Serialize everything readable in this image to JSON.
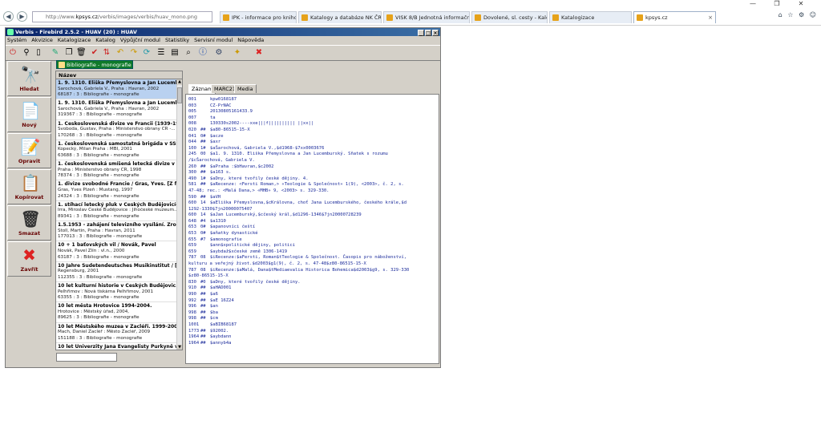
{
  "browser": {
    "address": {
      "prefix": "http://www.",
      "host": "kpsys.cz",
      "path": "/verbis/images/verbis/huav_mono.png"
    },
    "tabs": [
      {
        "label": "IPK - informace pro knihovny",
        "active": false
      },
      {
        "label": "Katalogy a databáze NK ČR",
        "active": false
      },
      {
        "label": "VISK 8/B Jednotná informační...",
        "active": false
      },
      {
        "label": "Dovolené, sl. cesty - Kalendář",
        "active": false
      },
      {
        "label": "Katalogizace",
        "active": false
      },
      {
        "label": "kpsys.cz",
        "active": true
      }
    ],
    "window_controls": {
      "minimize": "—",
      "maximize": "❐",
      "close": "✕"
    },
    "right_icons": "⌂ ☆ ⚙ ☺"
  },
  "app": {
    "title": "Verbis - Firebird 2.5.2 - HUAV (20) : HUAV",
    "menu": [
      "Systém",
      "Akvizice",
      "Katalogizace",
      "Katalog",
      "Výpůjční modul",
      "Statistiky",
      "Servisní modul",
      "Nápověda"
    ],
    "doc_tab": "Bibliografie - monografie",
    "actions": [
      {
        "label": "Hledat",
        "icon": "binoculars-icon",
        "glyph": "🔭"
      },
      {
        "label": "Nový",
        "icon": "new-document-icon",
        "glyph": "📄"
      },
      {
        "label": "Opravit",
        "icon": "edit-document-icon",
        "glyph": "📝"
      },
      {
        "label": "Kopírovat",
        "icon": "copy-document-icon",
        "glyph": "📋"
      },
      {
        "label": "Smazat",
        "icon": "trash-icon",
        "glyph": "🗑"
      },
      {
        "label": "Zavřít",
        "icon": "close-x-icon",
        "glyph": "✖"
      }
    ]
  },
  "list": {
    "header": "Název",
    "items": [
      {
        "title": "1. 9. 1310. Eliška Přemyslovna a Jan Lucemb...",
        "sub": "Šarochová, Gabriela V., Praha : Havran, 2002",
        "num": "68187 : 3 : Bibliografie - monografie",
        "selected": true
      },
      {
        "title": "1. 9. 1310. Eliška Přemyslovna a Jan Lucemb...",
        "sub": "Šarochová, Gabriela V., Praha : Havran, 2002",
        "num": "319367 : 3 : Bibliografie - monografie",
        "selected": false
      },
      {
        "title": "1. Československá divize ve Francii (1939-19...",
        "sub": "Svoboda, Gustav, Praha : Ministerstvo obrany ČR -...",
        "num": "170268 : 3 : Bibliografie - monografie",
        "selected": false
      },
      {
        "title": "1. československá samostatná brigáda v SSS...",
        "sub": "Kopecký, Milan Praha : MBI, 2001",
        "num": "63688 : 3 : Bibliografie - monografie",
        "selected": false
      },
      {
        "title": "1. československá smíšená letecká divize v S...",
        "sub": "Praha : Ministerstvo obrany ČR, 1998",
        "num": "78374 : 3 : Bibliografie - monografie",
        "selected": false
      },
      {
        "title": "1. divize svobodné Francie / Gras, Yves. [Z fr...",
        "sub": "Gras, Yves Plzeň : Mustang, 1997",
        "num": "24324 : 3 : Bibliografie - monografie",
        "selected": false
      },
      {
        "title": "1. stíhací letecký pluk v Českých Budějovicíc...",
        "sub": "Irra, Miroslav České Budějovice : Jihočeské muzeum...",
        "num": "89341 : 3 : Bibliografie - monografie",
        "selected": false
      },
      {
        "title": "1.5.1953 - zahájení televizního vysílání. Zroz...",
        "sub": "Štoll, Martin, Praha : Havran, 2011",
        "num": "177013 : 3 : Bibliografie - monografie",
        "selected": false
      },
      {
        "title": "10 + 1 baťovských vil / Novák, Pavel",
        "sub": "Novák, Pavel Zlín : vl.n., 2000",
        "num": "63187 : 3 : Bibliografie - monografie",
        "selected": false
      },
      {
        "title": "10 Jahre Sudetendeutsches Musikinstitut / [...",
        "sub": "Regensburg, 2001",
        "num": "112355 : 3 : Bibliografie - monografie",
        "selected": false
      },
      {
        "title": "10 let kulturní historie v Českých Budějovic...",
        "sub": "Pelhřimov : Nová tiskárna Pelhřimov, 2001",
        "num": "63355 : 3 : Bibliografie - monografie",
        "selected": false
      },
      {
        "title": "10 let města Hrotovice 1994-2004.",
        "sub": "Hrotovice : Městský úřad, 2004,",
        "num": "89625 : 3 : Bibliografie - monografie",
        "selected": false
      },
      {
        "title": "10 let Městského muzea v Žacléři. 1999-200...",
        "sub": "Mach, Daniel Žacléř : Město Žacléř, 2009",
        "num": "151188 : 3 : Bibliografie - monografie",
        "selected": false
      },
      {
        "title": "10 let Univerzity Jana Evangelisty Purkyně v...",
        "sub": "",
        "num": "",
        "selected": false
      }
    ]
  },
  "record": {
    "tabs": [
      "Záznam",
      "MARC21",
      "Media"
    ],
    "lines": [
      {
        "tag": "001",
        "ind": "",
        "text": "kpw0168187"
      },
      {
        "tag": "003",
        "ind": "",
        "text": "CZ-PrNAC"
      },
      {
        "tag": "005",
        "ind": "",
        "text": "20130805161433.9"
      },
      {
        "tag": "007",
        "ind": "",
        "text": "ta"
      },
      {
        "tag": "008",
        "ind": "",
        "text": "130330s2002----xxe|||f|||||||||| ||xx||"
      },
      {
        "tag": "020",
        "ind": "##",
        "text": "$a80-86515-15-X"
      },
      {
        "tag": "041",
        "ind": "0#",
        "text": "$acze"
      },
      {
        "tag": "044",
        "ind": "##",
        "text": "$axr"
      },
      {
        "tag": "100",
        "ind": "1#",
        "text": "$aŠarochová, Gabriela V.,$d1968-$7xx0003676"
      },
      {
        "tag": "245",
        "ind": "00",
        "text": "$a1. 9. 1310. Eliška Přemyslovna a Jan Lucemburský. Sňatek s rozumu"
      },
      {
        "tag": "",
        "ind": "",
        "text": "/$cŠarochová, Gabriela V."
      },
      {
        "tag": "260",
        "ind": "##",
        "text": "$aPraha :$bHavran,$c2002"
      },
      {
        "tag": "300",
        "ind": "##",
        "text": "$a163 s."
      },
      {
        "tag": "490",
        "ind": "1#",
        "text": "$aDny, které tvořily české dějiny. 4."
      },
      {
        "tag": "581",
        "ind": "##",
        "text": "$aRecenze: <Fersti Roman,> «Teologie & Společnost» 1(9), <2003>, č. 2, s."
      },
      {
        "tag": "",
        "ind": "",
        "text": "47-48; rec.: <Malá Dana,> «MHB» 9, <2003> s. 329-330."
      },
      {
        "tag": "590",
        "ind": "##",
        "text": "$aVH"
      },
      {
        "tag": "600",
        "ind": "14",
        "text": "$aEliška Přemyslovna,$cKrálovna, choť Jana Lucemburského, českého krále,$d"
      },
      {
        "tag": "",
        "ind": "",
        "text": "1292-1330$7jn20000075407"
      },
      {
        "tag": "600",
        "ind": "14",
        "text": "$aJan Lucemburský,$cčeský král,$d1296-1346$7jn20000728239"
      },
      {
        "tag": "648",
        "ind": "#4",
        "text": "$a1310"
      },
      {
        "tag": "653",
        "ind": "0#",
        "text": "$apanovníci čeští"
      },
      {
        "tag": "653",
        "ind": "0#",
        "text": "$aňatky dynastické"
      },
      {
        "tag": "655",
        "ind": "#7",
        "text": "$amonografie"
      },
      {
        "tag": "659",
        "ind": "",
        "text": "$ann$xpolitické dějiny, politici"
      },
      {
        "tag": "659",
        "ind": "",
        "text": "$aybdaž$xčeské země 1306-1419"
      },
      {
        "tag": "787",
        "ind": "08",
        "text": "$iRecenze:$aFersti, Roman$tTeologie & Společnost. Časopis pro náboženství,"
      },
      {
        "tag": "",
        "ind": "",
        "text": "kulturu a veřejný život.$d2003$g1(9), č. 2, s. 47-48$z80-86515-15-X"
      },
      {
        "tag": "787",
        "ind": "08",
        "text": "$iRecenze:$aMalá, Dana$tMediaevalia Historica Bohemica$d2003$g9, s. 329-330"
      },
      {
        "tag": "",
        "ind": "",
        "text": "$z80-86515-15-X"
      },
      {
        "tag": "830",
        "ind": "#0",
        "text": "$aDny, které tvořily české dějiny."
      },
      {
        "tag": "910",
        "ind": "##",
        "text": "$aHAD001"
      },
      {
        "tag": "990",
        "ind": "##",
        "text": "$a6"
      },
      {
        "tag": "992",
        "ind": "##",
        "text": "$aE 16Z24"
      },
      {
        "tag": "996",
        "ind": "##",
        "text": "$an"
      },
      {
        "tag": "998",
        "ind": "##",
        "text": "$ba"
      },
      {
        "tag": "998",
        "ind": "##",
        "text": "$cm"
      },
      {
        "tag": "1001",
        "ind": "",
        "text": "$aBIB68187"
      },
      {
        "tag": "1773",
        "ind": "##",
        "text": "$92002."
      },
      {
        "tag": "1964",
        "ind": "##",
        "text": "$aybdann"
      },
      {
        "tag": "1964",
        "ind": "##",
        "text": "$annyb4a"
      }
    ]
  }
}
